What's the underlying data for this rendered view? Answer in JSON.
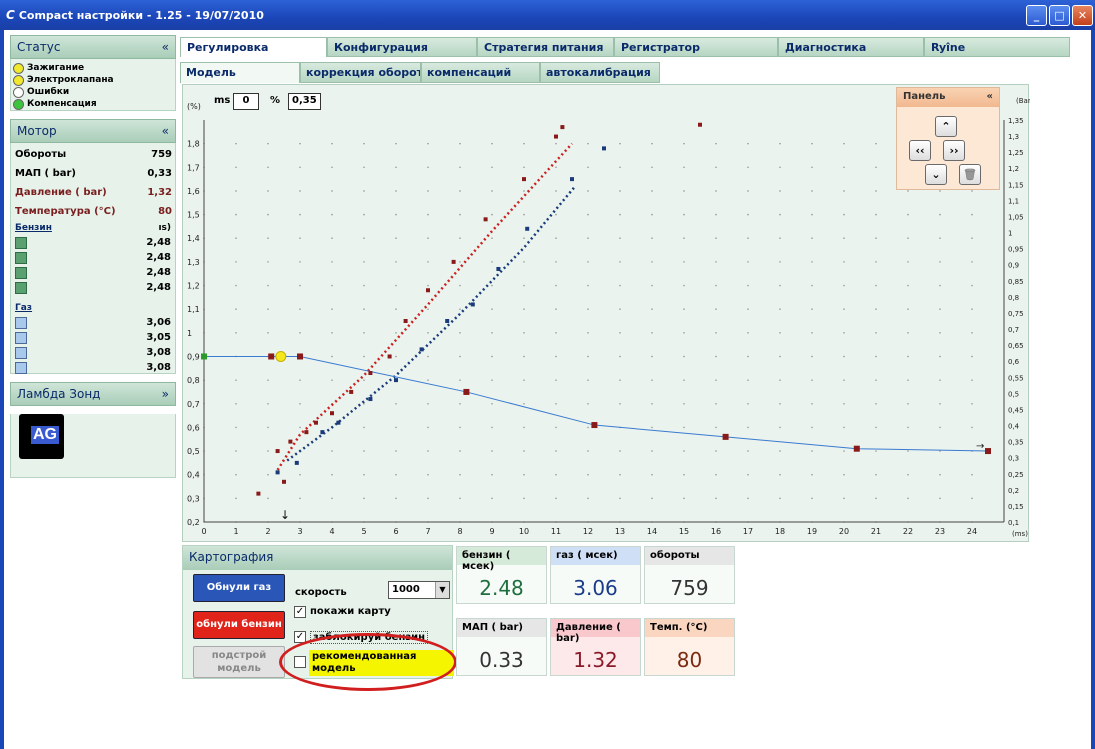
{
  "window": {
    "title": "Compact настройки - 1.25 - 19/07/2010",
    "app_icon": "C"
  },
  "status": {
    "title": "Статус",
    "items": [
      {
        "label": "Зажигание",
        "color": "#f2e82c"
      },
      {
        "label": "Электроклапана",
        "color": "#f2e82c"
      },
      {
        "label": "Ошибки",
        "color": "#ffffff"
      },
      {
        "label": "Компенсация",
        "color": "#3cc43c"
      }
    ]
  },
  "motor": {
    "title": "Мотор",
    "rows": [
      {
        "label": "Обороты",
        "value": "759"
      },
      {
        "label": "МАП ( bar)",
        "value": "0,33"
      },
      {
        "label": "Давление ( bar)",
        "value": "1,32"
      },
      {
        "label": "Температура (°C)",
        "value": "80"
      }
    ],
    "benzin_label": "Бензин",
    "benzin_unit": "ıs)",
    "benzin_values": [
      "2,48",
      "2,48",
      "2,48",
      "2,48"
    ],
    "gas_label": "Газ",
    "gas_values": [
      "3,06",
      "3,05",
      "3,08",
      "3,08"
    ]
  },
  "lambda": {
    "title": "Ламбда Зонд",
    "logo_text": "AG"
  },
  "tabs": [
    "Регулировка",
    "Конфигурация",
    "Стратегия питания",
    "Регистратор",
    "Диагностика",
    "Ryîne"
  ],
  "subtabs": [
    "Модель",
    "коррекция оборотов",
    "компенсаций",
    "автокалибрация"
  ],
  "controls": {
    "ms_label": "ms",
    "ms_value": "0",
    "pct_label": "%",
    "pct_value": "0,35"
  },
  "panel": {
    "title": "Панель"
  },
  "cartography": {
    "title": "Картография",
    "reset_gas": "Обнули газ",
    "reset_benzin": "обнули бензин",
    "adjust_model_1": "подстрой",
    "adjust_model_2": "модель",
    "speed_label": "скорость",
    "speed_value": "1000",
    "show_map": "покажи карту",
    "block_benzin": "заблокируй бензин",
    "recommended_1": "рекомендованная",
    "recommended_2": "модель"
  },
  "tiles": [
    {
      "title": "бензин ( мсек)",
      "value": "2.48",
      "color": "#1e6e3e"
    },
    {
      "title": "газ ( мсек)",
      "value": "3.06",
      "color": "#1a3b8a"
    },
    {
      "title": "обороты",
      "value": "759",
      "color": "#333333"
    },
    {
      "title": "МАП ( bar)",
      "value": "0.33",
      "color": "#333333"
    },
    {
      "title": "Давление ( bar)",
      "value": "1.32",
      "color": "#8a1a2a"
    },
    {
      "title": "Темп. (°C)",
      "value": "80",
      "color": "#7a2a10"
    }
  ],
  "chart_data": {
    "type": "scatter",
    "left_axis_label": "(%)",
    "right_axis_label": "(Bar)",
    "x_axis_label": "(ms)",
    "xlim": [
      0,
      25
    ],
    "ylim_left": [
      0.2,
      1.9
    ],
    "ylim_right": [
      0.1,
      1.35
    ],
    "x_ticks": [
      "0",
      "1",
      "2",
      "3",
      "4",
      "5",
      "6",
      "7",
      "8",
      "9",
      "10",
      "11",
      "12",
      "13",
      "14",
      "15",
      "16",
      "17",
      "18",
      "19",
      "20",
      "21",
      "22",
      "23",
      "24"
    ],
    "y_left_ticks": [
      "0,2",
      "0,3",
      "0,4",
      "0,5",
      "0,6",
      "0,7",
      "0,8",
      "0,9",
      "1",
      "1,1",
      "1,2",
      "1,3",
      "1,4",
      "1,5",
      "1,6",
      "1,7",
      "1,8"
    ],
    "y_right_ticks": [
      "0,1",
      "0,15",
      "0,2",
      "0,25",
      "0,3",
      "0,35",
      "0,4",
      "0,45",
      "0,5",
      "0,55",
      "0,6",
      "0,65",
      "0,7",
      "0,75",
      "0,8",
      "0,85",
      "0,9",
      "0,95",
      "1",
      "1,05",
      "1,1",
      "1,15",
      "1,2",
      "1,25",
      "1,3",
      "1,35"
    ],
    "model_curve": {
      "x": [
        0,
        2.1,
        2.4,
        3.0,
        8.2,
        12.2,
        16.3,
        20.4,
        24.5
      ],
      "y": [
        0.9,
        0.9,
        0.9,
        0.9,
        0.75,
        0.61,
        0.56,
        0.51,
        0.5
      ]
    },
    "benzin_points": {
      "x": [
        1.7,
        2.3,
        2.5,
        2.7,
        3.2,
        3.5,
        4.0,
        4.6,
        5.2,
        5.8,
        6.3,
        7.0,
        7.8,
        8.8,
        10.0,
        11.0,
        11.2
      ],
      "y": [
        0.32,
        0.5,
        0.37,
        0.54,
        0.58,
        0.62,
        0.66,
        0.75,
        0.83,
        0.9,
        1.05,
        1.18,
        1.3,
        1.48,
        1.65,
        1.83,
        1.87
      ]
    },
    "benzin_trend": {
      "x": [
        2.3,
        3.0,
        5.0,
        7.0,
        9.0,
        11.5
      ],
      "y": [
        0.42,
        0.57,
        0.82,
        1.12,
        1.43,
        1.8
      ]
    },
    "gas_points": {
      "x": [
        2.3,
        2.9,
        3.7,
        4.2,
        5.2,
        6.0,
        6.8,
        7.6,
        8.4,
        9.2,
        10.1,
        11.5,
        12.5
      ],
      "y": [
        0.41,
        0.45,
        0.58,
        0.62,
        0.72,
        0.8,
        0.93,
        1.05,
        1.12,
        1.27,
        1.44,
        1.65,
        1.78
      ]
    },
    "gas_trend": {
      "x": [
        2.6,
        4.0,
        6.0,
        8.0,
        10.0,
        11.6
      ],
      "y": [
        0.46,
        0.6,
        0.82,
        1.08,
        1.36,
        1.62
      ]
    },
    "outlier_point": {
      "x": 15.5,
      "y": 1.88
    },
    "marker_x": 2.5,
    "colors": {
      "benzin": "#cc1f1f",
      "gas": "#1a3b7a",
      "model": "#3a7ad0",
      "point": "#8a1a1a"
    }
  }
}
